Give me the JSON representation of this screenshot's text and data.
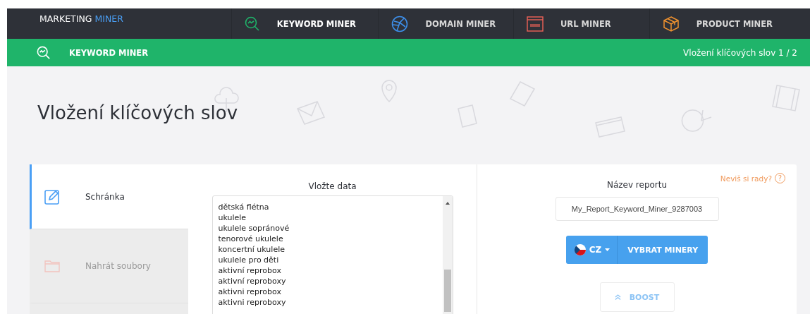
{
  "brand": {
    "first": "MARKETING",
    "second": "MINER"
  },
  "nav": [
    {
      "label": "KEYWORD MINER",
      "kind": "keyword",
      "selected": true
    },
    {
      "label": "DOMAIN MINER",
      "kind": "domain",
      "selected": false
    },
    {
      "label": "URL MINER",
      "kind": "url",
      "selected": false
    },
    {
      "label": "PRODUCT MINER",
      "kind": "product",
      "selected": false
    }
  ],
  "subbar": {
    "title": "KEYWORD MINER",
    "step": "Vložení klíčových slov 1 / 2"
  },
  "page_title": "Vložení klíčových slov",
  "source_tabs": [
    {
      "label": "Schránka",
      "kind": "clipboard",
      "selected": true
    },
    {
      "label": "Nahrát soubory",
      "kind": "upload",
      "selected": false
    },
    {
      "kind": "empty",
      "selected": false
    }
  ],
  "data_input": {
    "label": "Vložte data",
    "lines": [
      "dětská flétna",
      "ukulele",
      "ukulele sopránové",
      "tenorové ukulele",
      "koncertní ukulele",
      "ukulele pro děti",
      "aktivní reprobox",
      "aktivní reproboxy",
      "aktivni reprobox",
      "aktivni reproboxy"
    ]
  },
  "report": {
    "help": "Neviš si rady?",
    "help_icon": "?",
    "label": "Název reportu",
    "value": "My_Report_Keyword_Miner_9287003",
    "country": "CZ",
    "choose_button": "VYBRAT MINERY",
    "boost_button": "BOOST"
  }
}
